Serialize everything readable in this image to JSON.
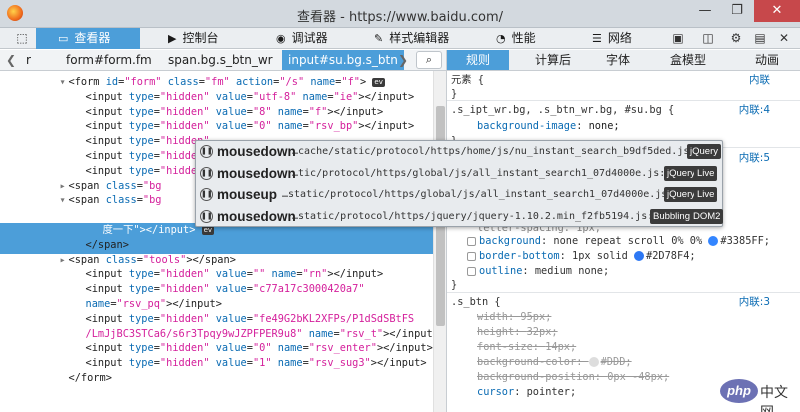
{
  "window": {
    "title": "查看器 - https://www.baidu.com/",
    "minimize": "—",
    "restore": "❐",
    "close": "✕"
  },
  "toolbar": {
    "tabs": [
      {
        "label": "查看器",
        "icon": "inspector-icon",
        "glyph": "▭"
      },
      {
        "label": "控制台",
        "icon": "console-icon",
        "glyph": "▶"
      },
      {
        "label": "调试器",
        "icon": "debugger-icon",
        "glyph": "◉"
      },
      {
        "label": "样式编辑器",
        "icon": "style-editor-icon",
        "glyph": "✎"
      },
      {
        "label": "性能",
        "icon": "performance-icon",
        "glyph": "◔"
      },
      {
        "label": "网络",
        "icon": "network-icon",
        "glyph": "☰"
      }
    ],
    "picker_glyph": "⬚",
    "right_icons": [
      "▣",
      "◫",
      "⚙",
      "▤",
      "✕"
    ]
  },
  "breadcrumbs": {
    "items": [
      "r",
      "form#form.fm",
      "span.bg.s_btn_wr",
      "input#su.bg.s_btn"
    ],
    "left_arrow": "❮",
    "right_arrow": "❯",
    "search_glyph": "⌕"
  },
  "sidebar_tabs": [
    "规则",
    "计算后",
    "字体",
    "盒模型",
    "动画"
  ],
  "markup_lines": [
    {
      "indent": 7,
      "tw": "▾",
      "parts": [
        [
          "tag",
          "<form "
        ],
        [
          "an",
          "id"
        ],
        [
          "tag",
          "="
        ],
        [
          "av",
          "\"form\""
        ],
        [
          "tag",
          " "
        ],
        [
          "an",
          "class"
        ],
        [
          "tag",
          "="
        ],
        [
          "av",
          "\"fm\""
        ],
        [
          "tag",
          " "
        ],
        [
          "an",
          "action"
        ],
        [
          "tag",
          "="
        ],
        [
          "av",
          "\"/s\""
        ],
        [
          "tag",
          " "
        ],
        [
          "an",
          "name"
        ],
        [
          "tag",
          "="
        ],
        [
          "av",
          "\"f\""
        ],
        [
          "tag",
          ">"
        ]
      ],
      "ev": "ev"
    },
    {
      "indent": 9,
      "parts": [
        [
          "tag",
          "<input "
        ],
        [
          "an",
          "type"
        ],
        [
          "tag",
          "="
        ],
        [
          "av",
          "\"hidden\""
        ],
        [
          "tag",
          " "
        ],
        [
          "an",
          "value"
        ],
        [
          "tag",
          "="
        ],
        [
          "av",
          "\"utf-8\""
        ],
        [
          "tag",
          " "
        ],
        [
          "an",
          "name"
        ],
        [
          "tag",
          "="
        ],
        [
          "av",
          "\"ie\""
        ],
        [
          "tag",
          "></input>"
        ]
      ]
    },
    {
      "indent": 9,
      "parts": [
        [
          "tag",
          "<input "
        ],
        [
          "an",
          "type"
        ],
        [
          "tag",
          "="
        ],
        [
          "av",
          "\"hidden\""
        ],
        [
          "tag",
          " "
        ],
        [
          "an",
          "value"
        ],
        [
          "tag",
          "="
        ],
        [
          "av",
          "\"8\""
        ],
        [
          "tag",
          " "
        ],
        [
          "an",
          "name"
        ],
        [
          "tag",
          "="
        ],
        [
          "av",
          "\"f\""
        ],
        [
          "tag",
          "></input>"
        ]
      ]
    },
    {
      "indent": 9,
      "parts": [
        [
          "tag",
          "<input "
        ],
        [
          "an",
          "type"
        ],
        [
          "tag",
          "="
        ],
        [
          "av",
          "\"hidden\""
        ],
        [
          "tag",
          " "
        ],
        [
          "an",
          "value"
        ],
        [
          "tag",
          "="
        ],
        [
          "av",
          "\"0\""
        ],
        [
          "tag",
          " "
        ],
        [
          "an",
          "name"
        ],
        [
          "tag",
          "="
        ],
        [
          "av",
          "\"rsv_bp\""
        ],
        [
          "tag",
          "></input>"
        ]
      ]
    },
    {
      "indent": 9,
      "parts": [
        [
          "tag",
          "<input "
        ],
        [
          "an",
          "type"
        ],
        [
          "tag",
          "="
        ],
        [
          "av",
          "\"hidden\""
        ]
      ]
    },
    {
      "indent": 9,
      "parts": [
        [
          "tag",
          "<input "
        ],
        [
          "an",
          "type"
        ],
        [
          "tag",
          "="
        ],
        [
          "av",
          "\"hidden\""
        ]
      ]
    },
    {
      "indent": 9,
      "parts": [
        [
          "tag",
          "<input "
        ],
        [
          "an",
          "type"
        ],
        [
          "tag",
          "="
        ],
        [
          "av",
          "\"hidden\""
        ]
      ]
    },
    {
      "indent": 7,
      "tw": "▸",
      "parts": [
        [
          "tag",
          "<span "
        ],
        [
          "an",
          "class"
        ],
        [
          "tag",
          "="
        ],
        [
          "av",
          "\"bg"
        ]
      ]
    },
    {
      "indent": 7,
      "tw": "▾",
      "parts": [
        [
          "tag",
          "<span "
        ],
        [
          "an",
          "class"
        ],
        [
          "tag",
          "="
        ],
        [
          "av",
          "\"bg"
        ]
      ]
    },
    {
      "indent": 11,
      "sel": true,
      "parts": [
        [
          "tag",
          "<input "
        ],
        [
          "an",
          "id"
        ],
        [
          "tag",
          "="
        ],
        [
          "av",
          "\"su\""
        ],
        [
          "tag",
          " "
        ],
        [
          "an",
          "class"
        ],
        [
          "tag",
          "="
        ],
        [
          "av",
          "\"bg s_btn\""
        ],
        [
          "tag",
          " "
        ],
        [
          "an",
          "type"
        ],
        [
          "tag",
          "="
        ],
        [
          "av",
          "\"submit\""
        ],
        [
          "tag",
          " "
        ],
        [
          "an",
          "value"
        ],
        [
          "tag",
          "="
        ],
        [
          "av",
          "\"百"
        ]
      ]
    },
    {
      "indent": 11,
      "sel": true,
      "parts": [
        [
          "av",
          "度一下\""
        ],
        [
          "tag",
          "></input>"
        ]
      ],
      "ev": "ev"
    },
    {
      "indent": 9,
      "parts": [
        [
          "tag",
          "</span>"
        ]
      ]
    },
    {
      "indent": 7,
      "tw": "▸",
      "parts": [
        [
          "tag",
          "<span "
        ],
        [
          "an",
          "class"
        ],
        [
          "tag",
          "="
        ],
        [
          "av",
          "\"tools\""
        ],
        [
          "tag",
          "></span>"
        ]
      ]
    },
    {
      "indent": 9,
      "parts": [
        [
          "tag",
          "<input "
        ],
        [
          "an",
          "type"
        ],
        [
          "tag",
          "="
        ],
        [
          "av",
          "\"hidden\""
        ],
        [
          "tag",
          " "
        ],
        [
          "an",
          "value"
        ],
        [
          "tag",
          "="
        ],
        [
          "av",
          "\"\""
        ],
        [
          "tag",
          " "
        ],
        [
          "an",
          "name"
        ],
        [
          "tag",
          "="
        ],
        [
          "av",
          "\"rn\""
        ],
        [
          "tag",
          "></input>"
        ]
      ]
    },
    {
      "indent": 9,
      "parts": [
        [
          "tag",
          "<input "
        ],
        [
          "an",
          "type"
        ],
        [
          "tag",
          "="
        ],
        [
          "av",
          "\"hidden\""
        ],
        [
          "tag",
          " "
        ],
        [
          "an",
          "value"
        ],
        [
          "tag",
          "="
        ],
        [
          "av",
          "\"c77a17c3000420a7\""
        ]
      ]
    },
    {
      "indent": 9,
      "parts": [
        [
          "an",
          "name"
        ],
        [
          "tag",
          "="
        ],
        [
          "av",
          "\"rsv_pq\""
        ],
        [
          "tag",
          "></input>"
        ]
      ]
    },
    {
      "indent": 9,
      "parts": [
        [
          "tag",
          "<input "
        ],
        [
          "an",
          "type"
        ],
        [
          "tag",
          "="
        ],
        [
          "av",
          "\"hidden\""
        ],
        [
          "tag",
          " "
        ],
        [
          "an",
          "value"
        ],
        [
          "tag",
          "="
        ],
        [
          "av",
          "\"fe49G2bKL2XFPs/P1dSdSBtFS"
        ]
      ]
    },
    {
      "indent": 9,
      "parts": [
        [
          "av",
          "/LmJjBC3STCa6/s6r3Tpqy9wJZPFPER9u8\""
        ],
        [
          "tag",
          " "
        ],
        [
          "an",
          "name"
        ],
        [
          "tag",
          "="
        ],
        [
          "av",
          "\"rsv_t\""
        ],
        [
          "tag",
          "></input>"
        ]
      ]
    },
    {
      "indent": 9,
      "parts": [
        [
          "tag",
          "<input "
        ],
        [
          "an",
          "type"
        ],
        [
          "tag",
          "="
        ],
        [
          "av",
          "\"hidden\""
        ],
        [
          "tag",
          " "
        ],
        [
          "an",
          "value"
        ],
        [
          "tag",
          "="
        ],
        [
          "av",
          "\"0\""
        ],
        [
          "tag",
          " "
        ],
        [
          "an",
          "name"
        ],
        [
          "tag",
          "="
        ],
        [
          "av",
          "\"rsv_enter\""
        ],
        [
          "tag",
          "></input>"
        ]
      ]
    },
    {
      "indent": 9,
      "parts": [
        [
          "tag",
          "<input "
        ],
        [
          "an",
          "type"
        ],
        [
          "tag",
          "="
        ],
        [
          "av",
          "\"hidden\""
        ],
        [
          "tag",
          " "
        ],
        [
          "an",
          "value"
        ],
        [
          "tag",
          "="
        ],
        [
          "av",
          "\"1\""
        ],
        [
          "tag",
          " "
        ],
        [
          "an",
          "name"
        ],
        [
          "tag",
          "="
        ],
        [
          "av",
          "\"rsv_sug3\""
        ],
        [
          "tag",
          "></input>"
        ]
      ]
    },
    {
      "indent": 7,
      "parts": [
        [
          "tag",
          "</form>"
        ]
      ]
    }
  ],
  "event_tooltip": [
    {
      "event": "mousedown",
      "location": "…cache/static/protocol/https/home/js/nu_instant_search_b9df5ded.js:1",
      "badges": [
        "jQuery"
      ]
    },
    {
      "event": "mousedown",
      "location": "…tic/protocol/https/global/js/all_instant_search1_07d4000e.js:58",
      "badges": [
        "jQuery",
        "Live"
      ]
    },
    {
      "event": "mouseup",
      "location": "…static/protocol/https/global/js/all_instant_search1_07d4000e.js:58",
      "badges": [
        "jQuery",
        "Live"
      ]
    },
    {
      "event": "mousedown",
      "location": "…static/protocol/https/jquery/jquery-1.10.2.min_f2fb5194.js:41",
      "badges": [
        "Bubbling",
        "DOM2"
      ]
    }
  ],
  "rules": {
    "element": {
      "selector": "元素 {",
      "source": "内联",
      "close": "}"
    },
    "rule1": {
      "selector": ".s_ipt_wr.bg, .s_btn_wr.bg, #su.bg {",
      "source": "内联:4",
      "prop": "background-image",
      "value": "none;",
      "close": "}"
    },
    "rule2": {
      "source": "内联:5",
      "partial": "letter-spacing: 1px;",
      "props": [
        {
          "name": "background",
          "value": "none repeat scroll 0% 0%",
          "color": "#3385FF",
          "color_text": "#3385FF;"
        },
        {
          "name": "border-bottom",
          "value": "1px solid",
          "color": "#2D78F4",
          "color_text": "#2D78F4;"
        },
        {
          "name": "outline",
          "value": "medium none;"
        }
      ],
      "close": "}"
    },
    "rule3": {
      "selector": ".s_btn {",
      "source": "内联:3",
      "props": [
        {
          "name": "width",
          "value": "95px;",
          "struck": true
        },
        {
          "name": "height",
          "value": "32px;",
          "struck": true
        },
        {
          "name": "font-size",
          "value": "14px;",
          "struck": true
        },
        {
          "name": "background-color",
          "value": "",
          "color": "#DDDDDD",
          "color_text": "#DDD;",
          "struck": true
        },
        {
          "name": "background-position",
          "value": "0px -48px;",
          "struck": true
        },
        {
          "name": "cursor",
          "value": "pointer;",
          "struck": false
        }
      ]
    }
  },
  "watermark": {
    "logo": "php",
    "text": "中文网"
  }
}
